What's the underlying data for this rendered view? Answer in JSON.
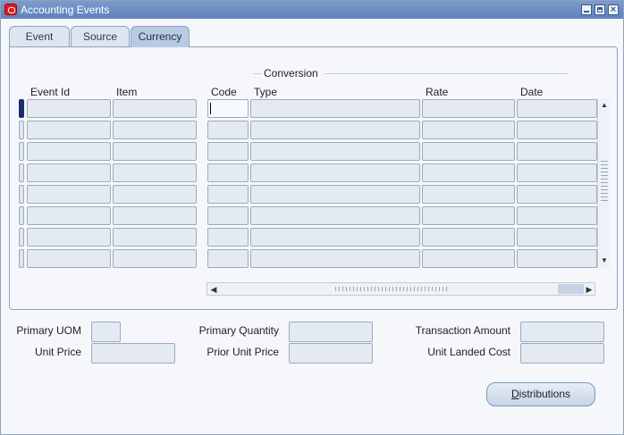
{
  "window": {
    "title": "Accounting Events"
  },
  "tabs": [
    {
      "label": "Event",
      "active": false
    },
    {
      "label": "Source",
      "active": false
    },
    {
      "label": "Currency",
      "active": true
    }
  ],
  "grid": {
    "group_label": "Conversion",
    "columns": [
      "Event Id",
      "Item",
      "Code",
      "Type",
      "Rate",
      "Date"
    ],
    "row_count": 8
  },
  "fields": {
    "primary_uom": {
      "label": "Primary UOM",
      "value": ""
    },
    "unit_price": {
      "label": "Unit Price",
      "value": ""
    },
    "primary_quantity": {
      "label": "Primary Quantity",
      "value": ""
    },
    "prior_unit_price": {
      "label": "Prior Unit Price",
      "value": ""
    },
    "transaction_amount": {
      "label": "Transaction Amount",
      "value": ""
    },
    "unit_landed_cost": {
      "label": "Unit Landed Cost",
      "value": ""
    }
  },
  "buttons": {
    "distributions": {
      "mnemonic": "D",
      "rest": "istributions"
    }
  },
  "colors": {
    "titlebar": "#6f8ec4",
    "active_tab": "#b9cbe4",
    "field_bg": "#e4eaf2",
    "current_row_indicator": "#1a2e6b"
  }
}
